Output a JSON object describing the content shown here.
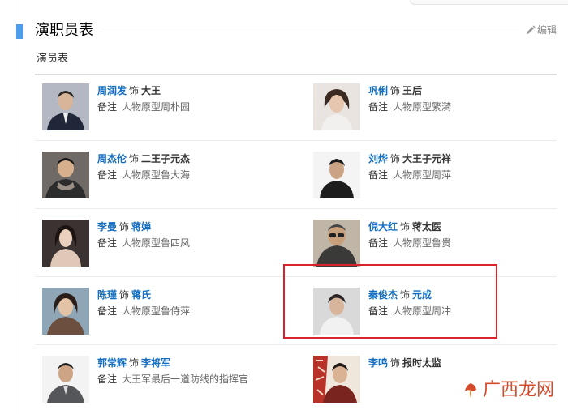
{
  "section": {
    "title": "演职员表",
    "edit_label": "编辑"
  },
  "subsection": {
    "title": "演员表"
  },
  "note_label": "备注",
  "shi": "饰",
  "cast": [
    {
      "actor": "周润发",
      "role": "大王",
      "role_link": false,
      "note": "人物原型周朴园"
    },
    {
      "actor": "巩俐",
      "role": "王后",
      "role_link": false,
      "note": "人物原型繁漪"
    },
    {
      "actor": "周杰伦",
      "role": "二王子元杰",
      "role_link": false,
      "note": "人物原型鲁大海"
    },
    {
      "actor": "刘烨",
      "role": "大王子元祥",
      "role_link": false,
      "note": "人物原型周萍"
    },
    {
      "actor": "李曼",
      "role": "蒋婵",
      "role_link": true,
      "note": "人物原型鲁四凤"
    },
    {
      "actor": "倪大红",
      "role": "蒋太医",
      "role_link": false,
      "note": "人物原型鲁贵"
    },
    {
      "actor": "陈瑾",
      "role": "蒋氏",
      "role_link": true,
      "note": "人物原型鲁侍萍"
    },
    {
      "actor": "秦俊杰",
      "role": "元成",
      "role_link": true,
      "note": "人物原型周冲"
    },
    {
      "actor": "郭常辉",
      "role": "李将军",
      "role_link": true,
      "note": "大王军最后一道防线的指挥官"
    },
    {
      "actor": "李鸣",
      "role": "报时太监",
      "role_link": false,
      "note": ""
    }
  ],
  "watermark": {
    "text": "广西龙网"
  },
  "colors": {
    "link": "#136ec2",
    "accent": "#4f9cee",
    "highlight": "#d9232a",
    "watermark": "#d34b2c"
  }
}
